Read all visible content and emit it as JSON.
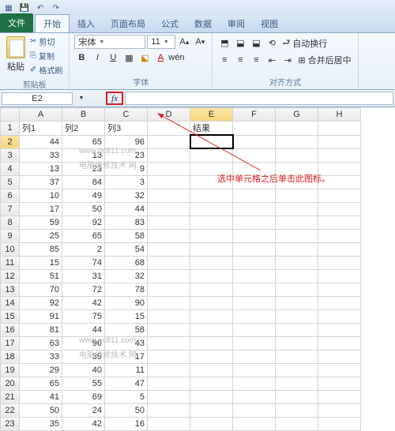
{
  "qat": {
    "save": "💾",
    "undo": "↶",
    "redo": "↷"
  },
  "tabs": {
    "file": "文件",
    "home": "开始",
    "insert": "插入",
    "pagelayout": "页面布局",
    "formula": "公式",
    "data": "数据",
    "review": "审阅",
    "view": "视图"
  },
  "ribbon": {
    "paste": "粘贴",
    "cut": "剪切",
    "copy": "复制",
    "fmtpainter": "格式刷",
    "clipboard_label": "剪贴板",
    "font_name": "宋体",
    "font_size": "11",
    "font_label": "字体",
    "wrap": "自动换行",
    "merge": "合并后居中",
    "align_label": "对齐方式"
  },
  "namebox": "E2",
  "fx": "fx",
  "columns": [
    "A",
    "B",
    "C",
    "D",
    "E",
    "F",
    "G",
    "H"
  ],
  "headers": {
    "c1": "列1",
    "c2": "列2",
    "c3": "列3",
    "result": "结果"
  },
  "rows": [
    [
      44,
      65,
      96
    ],
    [
      33,
      13,
      23
    ],
    [
      13,
      23,
      9
    ],
    [
      37,
      84,
      3
    ],
    [
      10,
      49,
      32
    ],
    [
      17,
      50,
      44
    ],
    [
      59,
      92,
      83
    ],
    [
      25,
      65,
      58
    ],
    [
      85,
      2,
      54
    ],
    [
      15,
      74,
      68
    ],
    [
      51,
      31,
      32
    ],
    [
      70,
      72,
      78
    ],
    [
      92,
      42,
      90
    ],
    [
      91,
      75,
      15
    ],
    [
      81,
      44,
      58
    ],
    [
      63,
      96,
      43
    ],
    [
      33,
      39,
      17
    ],
    [
      29,
      40,
      11
    ],
    [
      65,
      55,
      47
    ],
    [
      41,
      69,
      5
    ],
    [
      50,
      24,
      50
    ],
    [
      35,
      42,
      16
    ]
  ],
  "annotation": "选中单元格之后单击此图标。",
  "watermarks": {
    "w1": "www.pc811.com",
    "w2": "电脑维修技术 网",
    "w3": "www.pc811.com",
    "w4": "电脑维修技术 网"
  }
}
